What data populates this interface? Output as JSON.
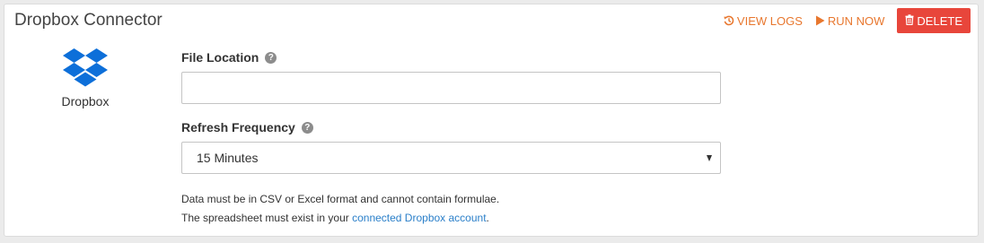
{
  "connector": {
    "title": "Dropbox Connector",
    "logo_label": "Dropbox",
    "logo_icon": "dropbox-logo-icon",
    "brand_color": "#0d6fd9"
  },
  "actions": {
    "view_logs_label": "VIEW LOGS",
    "view_logs_icon": "history-icon",
    "run_now_label": "RUN NOW",
    "run_now_icon": "play-icon",
    "delete_label": "DELETE",
    "delete_icon": "trash-icon",
    "accent_color": "#e8772e",
    "delete_color": "#e8463b"
  },
  "form": {
    "file_location": {
      "label": "File Location",
      "value": "",
      "placeholder": "",
      "help_icon": "question-circle-icon"
    },
    "refresh_frequency": {
      "label": "Refresh Frequency",
      "selected": "15 Minutes",
      "help_icon": "question-circle-icon"
    }
  },
  "help": {
    "line1": "Data must be in CSV or Excel format and cannot contain formulae.",
    "line2_prefix": "The spreadsheet must exist in your ",
    "line2_link": "connected Dropbox account",
    "line2_suffix": ".",
    "link_color": "#2a7fc9"
  }
}
